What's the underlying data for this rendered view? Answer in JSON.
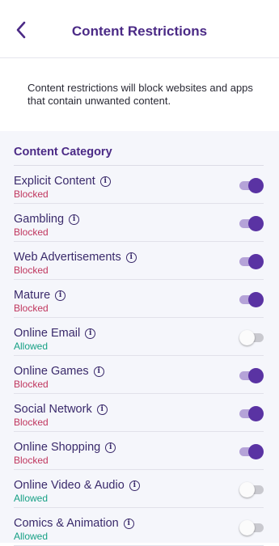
{
  "header": {
    "title": "Content Restrictions",
    "back_icon": "chevron-left-icon"
  },
  "description": "Content restrictions will block websites and apps that contain unwanted content.",
  "section": {
    "title": "Content Category"
  },
  "colors": {
    "accent": "#5a33a3",
    "title": "#4b2a86",
    "blocked": "#c0365e",
    "allowed": "#16a085"
  },
  "categories": [
    {
      "name": "Explicit Content",
      "status": "Blocked",
      "enabled": true
    },
    {
      "name": "Gambling",
      "status": "Blocked",
      "enabled": true
    },
    {
      "name": "Web Advertisements",
      "status": "Blocked",
      "enabled": true
    },
    {
      "name": "Mature",
      "status": "Blocked",
      "enabled": true
    },
    {
      "name": "Online Email",
      "status": "Allowed",
      "enabled": false
    },
    {
      "name": "Online Games",
      "status": "Blocked",
      "enabled": true
    },
    {
      "name": "Social Network",
      "status": "Blocked",
      "enabled": true
    },
    {
      "name": "Online Shopping",
      "status": "Blocked",
      "enabled": true
    },
    {
      "name": "Online Video & Audio",
      "status": "Allowed",
      "enabled": false
    },
    {
      "name": "Comics & Animation",
      "status": "Allowed",
      "enabled": false
    }
  ]
}
